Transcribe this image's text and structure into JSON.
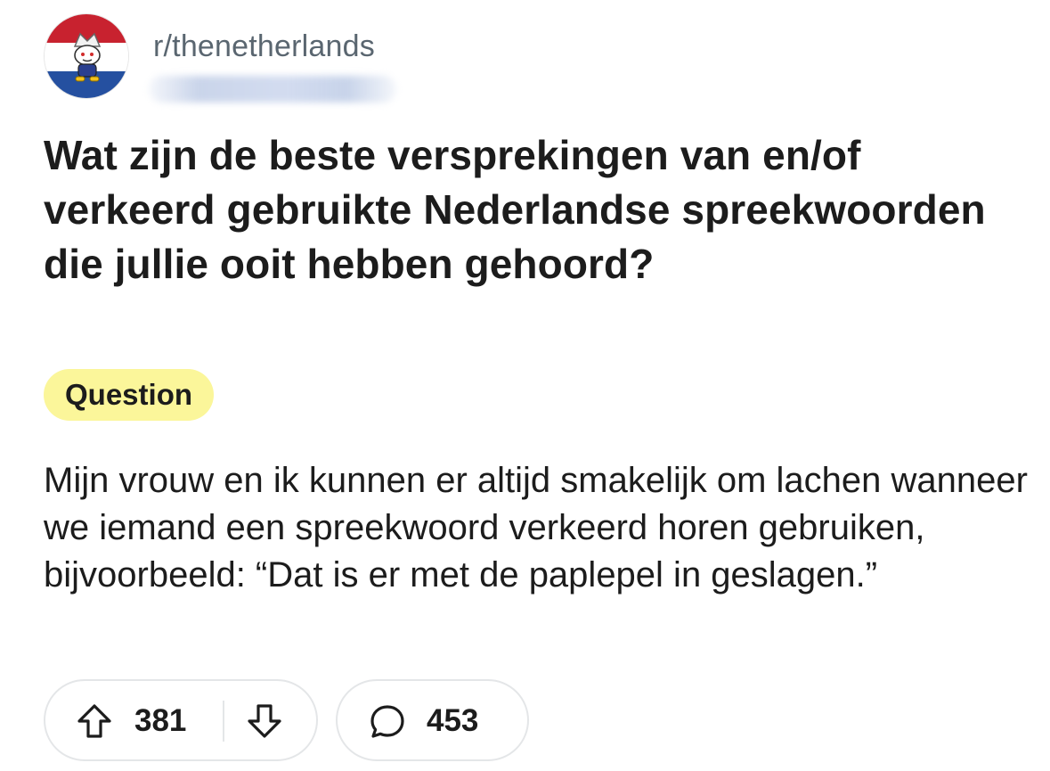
{
  "subreddit": {
    "name": "r/thenetherlands",
    "icon": "dutch-flag-snoo-icon",
    "flag_colors": [
      "#c8222f",
      "#ffffff",
      "#2550a0"
    ]
  },
  "post": {
    "title": "Wat zijn de beste versprekingen van en/of verkeerd gebruikte Nederlandse spreekwoorden die jullie ooit hebben gehoord?",
    "flair": "Question",
    "flair_color": "#fbf69a",
    "body": "Mijn vrouw en ik kunnen er altijd smakelijk om lachen wanneer we iemand een spreekwoord verkeerd horen gebruiken, bijvoorbeeld: “Dat is er met de paplepel in geslagen.”"
  },
  "actions": {
    "upvote_icon": "upvote-arrow-icon",
    "vote_count": "381",
    "downvote_icon": "downvote-arrow-icon",
    "comment_icon": "comment-bubble-icon",
    "comment_count": "453"
  }
}
